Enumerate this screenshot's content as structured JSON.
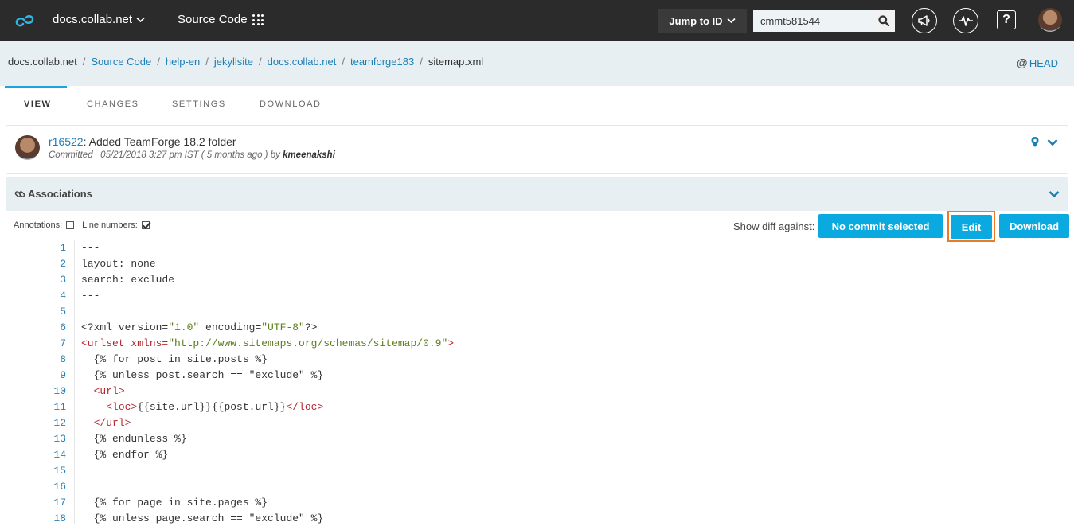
{
  "topbar": {
    "site": "docs.collab.net",
    "source_code": "Source Code",
    "jump_label": "Jump to ID",
    "search_value": "cmmt581544"
  },
  "breadcrumb": {
    "items": [
      "docs.collab.net",
      "Source Code",
      "help-en",
      "jekyllsite",
      "docs.collab.net",
      "teamforge183",
      "sitemap.xml"
    ],
    "sep": "/",
    "head": "HEAD",
    "at": "@"
  },
  "tabs": [
    "VIEW",
    "CHANGES",
    "SETTINGS",
    "DOWNLOAD"
  ],
  "commit": {
    "rev": "r16522",
    "message": ": Added TeamForge 18.2 folder",
    "committed": "Committed   05/21/2018 3:27 pm IST ( 5 months ago ) by ",
    "author": "kmeenakshi"
  },
  "associations": "Associations",
  "options": {
    "annotations": "Annotations:",
    "line_numbers": "Line numbers:",
    "show_diff": "Show diff against:",
    "no_commit": "No commit selected",
    "edit": "Edit",
    "download": "Download"
  },
  "code": [
    {
      "n": "1",
      "parts": [
        [
          "",
          "---"
        ]
      ]
    },
    {
      "n": "2",
      "parts": [
        [
          "",
          "layout: none"
        ]
      ]
    },
    {
      "n": "3",
      "parts": [
        [
          "",
          "search: exclude"
        ]
      ]
    },
    {
      "n": "4",
      "parts": [
        [
          "",
          "---"
        ]
      ]
    },
    {
      "n": "5",
      "parts": [
        [
          "",
          ""
        ]
      ]
    },
    {
      "n": "6",
      "parts": [
        [
          "",
          "<?xml version="
        ],
        [
          "str",
          "\"1.0\""
        ],
        [
          "",
          " encoding="
        ],
        [
          "str",
          "\"UTF-8\""
        ],
        [
          "",
          "?>"
        ]
      ]
    },
    {
      "n": "7",
      "parts": [
        [
          "tag",
          "<urlset xmlns="
        ],
        [
          "str",
          "\"http://www.sitemaps.org/schemas/sitemap/0.9\""
        ],
        [
          "tag",
          ">"
        ]
      ]
    },
    {
      "n": "8",
      "parts": [
        [
          "",
          "  {% for post in site.posts %}"
        ]
      ]
    },
    {
      "n": "9",
      "parts": [
        [
          "",
          "  {% unless post.search == \"exclude\" %}"
        ]
      ]
    },
    {
      "n": "10",
      "parts": [
        [
          "",
          "  "
        ],
        [
          "tag",
          "<url>"
        ]
      ]
    },
    {
      "n": "11",
      "parts": [
        [
          "",
          "    "
        ],
        [
          "tag",
          "<loc>"
        ],
        [
          "",
          "{{site.url}}{{post.url}}"
        ],
        [
          "tag",
          "</loc>"
        ]
      ]
    },
    {
      "n": "12",
      "parts": [
        [
          "",
          "  "
        ],
        [
          "tag",
          "</url>"
        ]
      ]
    },
    {
      "n": "13",
      "parts": [
        [
          "",
          "  {% endunless %}"
        ]
      ]
    },
    {
      "n": "14",
      "parts": [
        [
          "",
          "  {% endfor %}"
        ]
      ]
    },
    {
      "n": "15",
      "parts": [
        [
          "",
          ""
        ]
      ]
    },
    {
      "n": "16",
      "parts": [
        [
          "",
          ""
        ]
      ]
    },
    {
      "n": "17",
      "parts": [
        [
          "",
          "  {% for page in site.pages %}"
        ]
      ]
    },
    {
      "n": "18",
      "parts": [
        [
          "",
          "  {% unless page.search == \"exclude\" %}"
        ]
      ]
    }
  ],
  "colors": {
    "topbar": "#2b2b2b",
    "accent": "#0aa9e0",
    "link": "#1b7eb5",
    "highlight": "#ea7a23",
    "xml_tag": "#b7282e",
    "xml_string": "#5a7f1b"
  }
}
